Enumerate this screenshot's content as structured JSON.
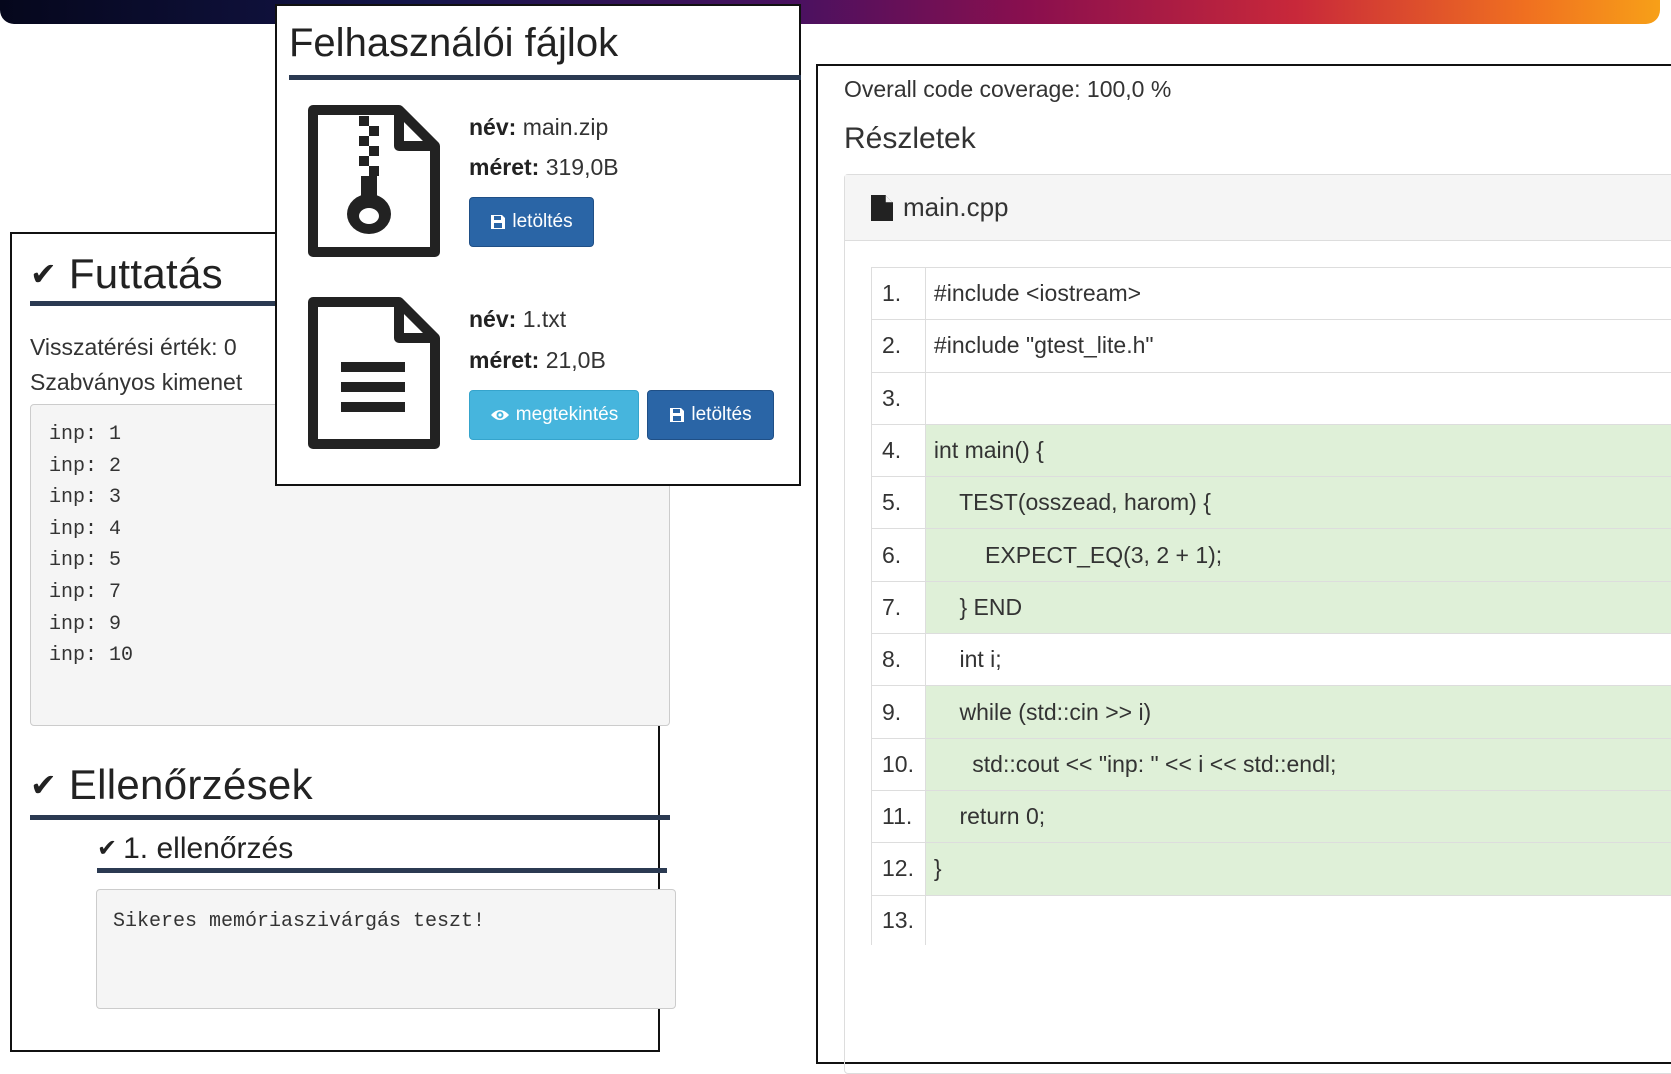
{
  "run": {
    "title": "Futtatás",
    "exit_line": "Visszatérési érték: 0",
    "stdout_label": "Szabványos kimenet",
    "stdout_lines": [
      "inp: 1",
      "inp: 2",
      "inp: 3",
      "inp: 4",
      "inp: 5",
      "inp: 7",
      "inp: 9",
      "inp: 10"
    ],
    "checks_title": "Ellenőrzések",
    "check1_title": "1. ellenőrzés",
    "check1_output": "Sikeres memóriaszivárgás teszt!"
  },
  "files": {
    "title": "Felhasználói fájlok",
    "name_label": "név:",
    "size_label": "méret:",
    "items": [
      {
        "icon": "zip-file-icon",
        "name": "main.zip",
        "size": "319,0B",
        "download_label": "letöltés"
      },
      {
        "icon": "text-file-icon",
        "name": "1.txt",
        "size": "21,0B",
        "view_label": "megtekintés",
        "download_label": "letöltés"
      }
    ]
  },
  "coverage": {
    "overall": "Overall code coverage: 100,0 %",
    "details_title": "Részletek",
    "file_name": "main.cpp",
    "covered_color": "#dff0d8",
    "lines": [
      {
        "n": "1.",
        "code": "#include <iostream>",
        "covered": false
      },
      {
        "n": "2.",
        "code": "#include \"gtest_lite.h\"",
        "covered": false
      },
      {
        "n": "3.",
        "code": "",
        "covered": false
      },
      {
        "n": "4.",
        "code": "int main() {",
        "covered": true
      },
      {
        "n": "5.",
        "code": "    TEST(osszead, harom) {",
        "covered": true
      },
      {
        "n": "6.",
        "code": "        EXPECT_EQ(3, 2 + 1);",
        "covered": true
      },
      {
        "n": "7.",
        "code": "    } END",
        "covered": true
      },
      {
        "n": "8.",
        "code": "    int i;",
        "covered": false
      },
      {
        "n": "9.",
        "code": "    while (std::cin >> i)",
        "covered": true
      },
      {
        "n": "10.",
        "code": "      std::cout << \"inp: \" << i << std::endl;",
        "covered": true
      },
      {
        "n": "11.",
        "code": "    return 0;",
        "covered": true
      },
      {
        "n": "12.",
        "code": "}",
        "covered": true
      },
      {
        "n": "13.",
        "code": "",
        "covered": false
      }
    ]
  }
}
